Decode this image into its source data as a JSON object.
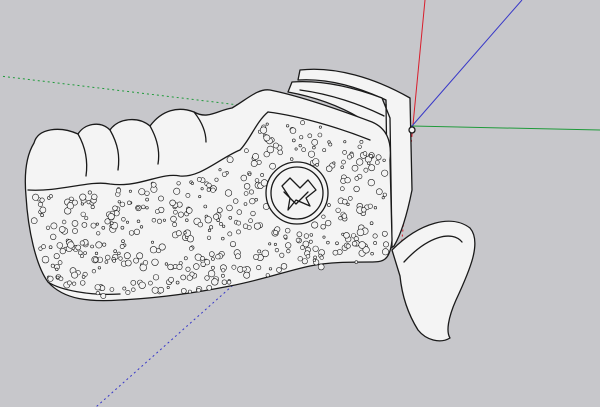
{
  "viewport": {
    "background_color": "#c7c7cb",
    "model_color": "#f4f4f4",
    "edge_color": "#1a1a1a",
    "axes": {
      "red_color": "#d81e2c",
      "green_color": "#1f9a3a",
      "blue_color": "#3838c8"
    },
    "model_parts": [
      "grip-body",
      "finger-grooves",
      "stippled-texture",
      "logo-emblem",
      "rail-mount",
      "trigger-guard-extension"
    ]
  }
}
